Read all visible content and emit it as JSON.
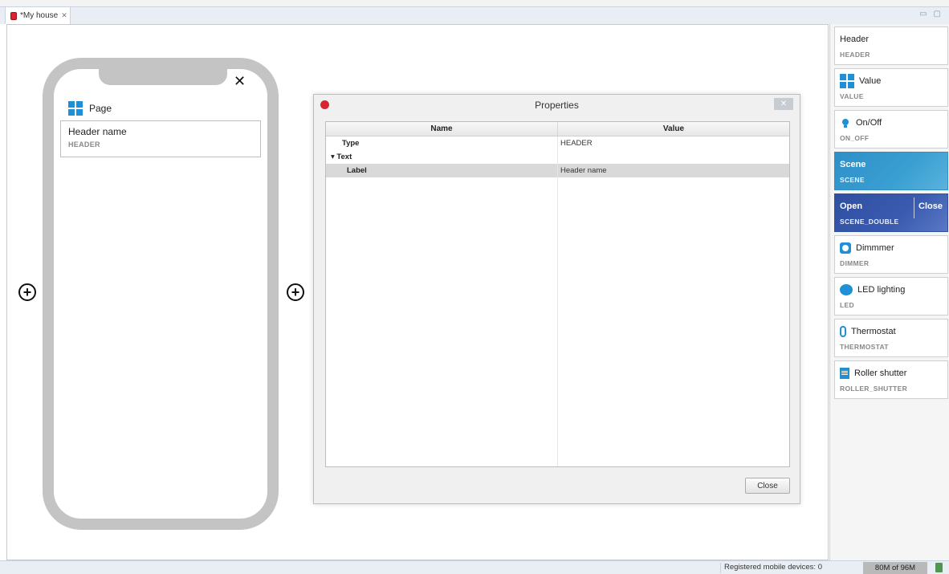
{
  "tab": {
    "title": "*My house",
    "close_glyph": "✕"
  },
  "window_controls": {
    "minimize": "▭",
    "maximize": "▢"
  },
  "phone": {
    "close_glyph": "✕",
    "page_label": "Page",
    "header_card": {
      "title": "Header name",
      "type": "HEADER"
    },
    "add_glyph": "+"
  },
  "dialog": {
    "title": "Properties",
    "close_x": "✕",
    "columns": [
      "Name",
      "Value"
    ],
    "rows": [
      {
        "name": "Type",
        "value": "HEADER"
      },
      {
        "name": "▾ Text",
        "value": ""
      },
      {
        "name": "Label",
        "value": "Header name"
      }
    ],
    "close_button": "Close"
  },
  "palette": {
    "items": [
      {
        "title": "Header",
        "type": "HEADER",
        "icon": "none"
      },
      {
        "title": "Value",
        "type": "VALUE",
        "icon": "grid-icon"
      },
      {
        "title": "On/Off",
        "type": "ON_OFF",
        "icon": "bulb-icon"
      },
      {
        "title": "Scene",
        "type": "SCENE",
        "icon": "none"
      },
      {
        "title_left": "Open",
        "title_right": "Close",
        "type": "SCENE_DOUBLE",
        "icon": "none"
      },
      {
        "title": "Dimmmer",
        "type": "DIMMER",
        "icon": "dimmer-icon"
      },
      {
        "title": "LED lighting",
        "type": "LED",
        "icon": "led-icon"
      },
      {
        "title": "Thermostat",
        "type": "THERMOSTAT",
        "icon": "thermometer-icon"
      },
      {
        "title": "Roller shutter",
        "type": "ROLLER_SHUTTER",
        "icon": "roller-shutter-icon"
      }
    ]
  },
  "status": {
    "devices": "Registered mobile devices: 0",
    "memory": "80M of 96M"
  },
  "colors": {
    "accent": "#1f8fd6",
    "scene": "#2e8fc7",
    "scene_double": "#2f4fa0",
    "app_red": "#d9232e"
  }
}
